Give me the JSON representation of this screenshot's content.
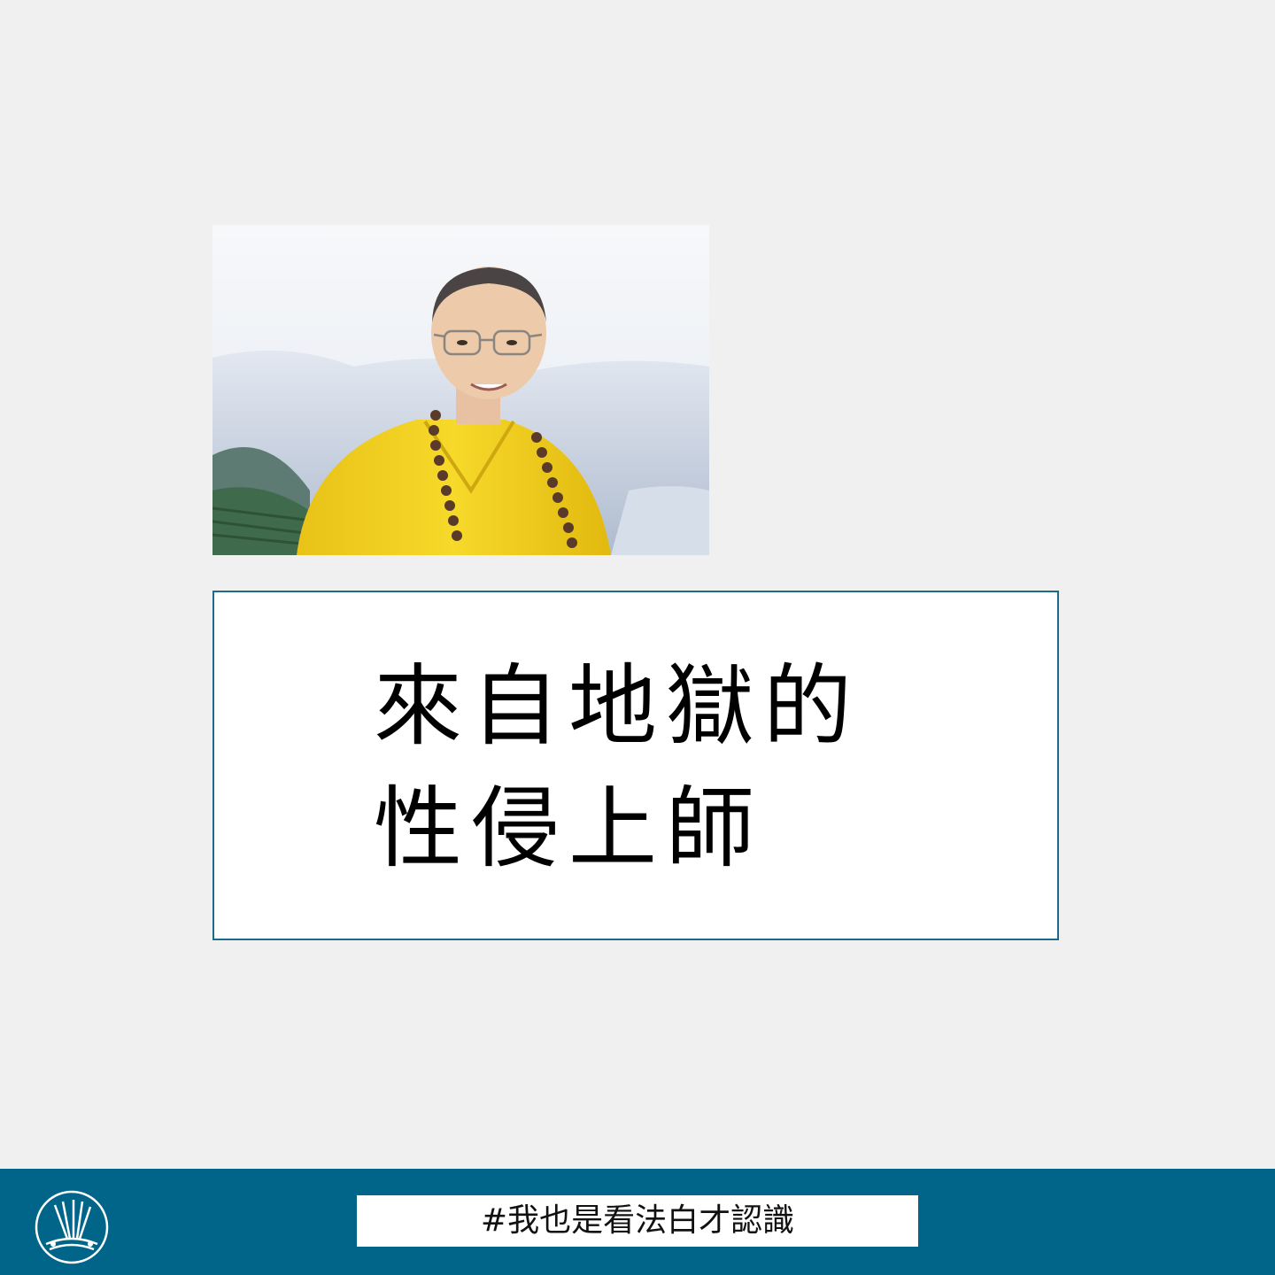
{
  "title": {
    "line1": "來自地獄的",
    "line2": "性侵上師"
  },
  "footer": {
    "hashtag": "#我也是看法白才認識"
  },
  "colors": {
    "background": "#f0f0f0",
    "accent": "#006588",
    "box_border": "#1c6a8c",
    "robe": "#f2cf1f"
  },
  "icons": {
    "logo": "brand-logo-icon"
  }
}
